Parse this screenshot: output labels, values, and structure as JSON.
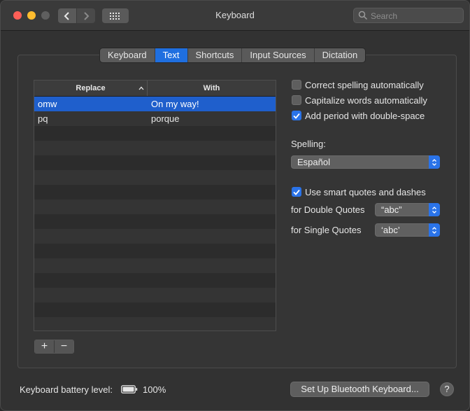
{
  "window": {
    "title": "Keyboard",
    "search_placeholder": "Search"
  },
  "tabs": [
    {
      "label": "Keyboard",
      "active": false
    },
    {
      "label": "Text",
      "active": true
    },
    {
      "label": "Shortcuts",
      "active": false
    },
    {
      "label": "Input Sources",
      "active": false
    },
    {
      "label": "Dictation",
      "active": false
    }
  ],
  "table": {
    "header_replace": "Replace",
    "header_with": "With",
    "rows": [
      {
        "replace": "omw",
        "with": "On my way!",
        "selected": true
      },
      {
        "replace": "pq",
        "with": "porque",
        "selected": false
      }
    ]
  },
  "controls": {
    "add_label": "+",
    "remove_label": "−"
  },
  "options": {
    "correct_spelling": {
      "label": "Correct spelling automatically",
      "checked": false
    },
    "capitalize_words": {
      "label": "Capitalize words automatically",
      "checked": false
    },
    "period_double_space": {
      "label": "Add period with double-space",
      "checked": true
    },
    "spelling_label": "Spelling:",
    "spelling_value": "Español",
    "smart_quotes": {
      "label": "Use smart quotes and dashes",
      "checked": true
    },
    "double_quotes_label": "for Double Quotes",
    "double_quotes_value": "“abc”",
    "single_quotes_label": "for Single Quotes",
    "single_quotes_value": "‘abc’"
  },
  "footer": {
    "battery_label": "Keyboard battery level:",
    "battery_percent": "100%",
    "bluetooth_button": "Set Up Bluetooth Keyboard...",
    "help_label": "?"
  },
  "colors": {
    "accent": "#1f6fe0",
    "selection": "#1f5fcc"
  }
}
